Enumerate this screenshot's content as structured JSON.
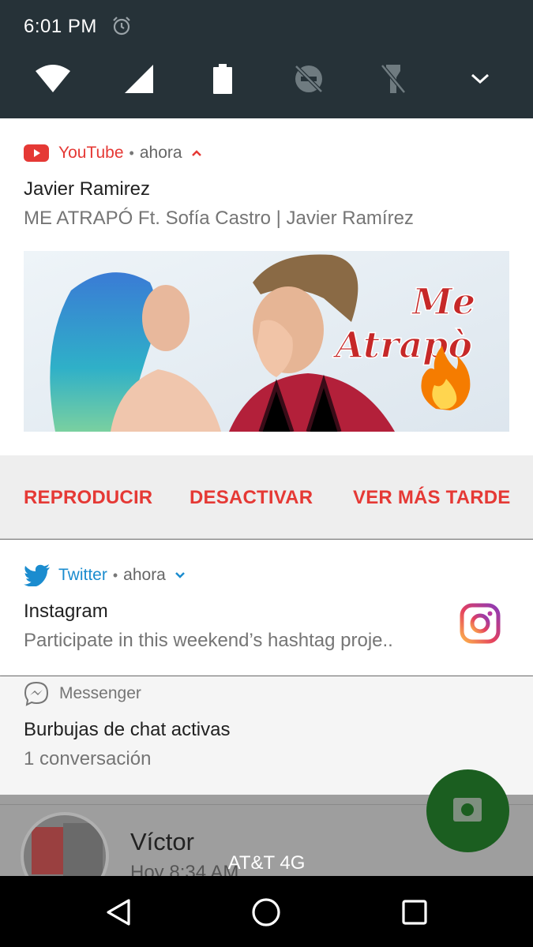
{
  "status_bar": {
    "time": "6:01 PM"
  },
  "youtube_notification": {
    "app_name": "YouTube",
    "time": "ahora",
    "title": "Javier Ramirez",
    "text": "ME ATRAPÓ Ft. Sofía Castro | Javier Ramírez",
    "thumbnail_text_line1": "Me",
    "thumbnail_text_line2": "Atrapò",
    "actions": [
      "REPRODUCIR",
      "DESACTIVAR",
      "VER MÁS TARDE"
    ],
    "accent_color": "#e53935"
  },
  "twitter_notification": {
    "app_name": "Twitter",
    "time": "ahora",
    "title": "Instagram",
    "text": "Participate in this weekend’s hashtag proje..",
    "accent_color": "#1b8ccf"
  },
  "messenger_notification": {
    "app_name": "Messenger",
    "title": "Burbujas de chat activas",
    "text": "1 conversación"
  },
  "background_app": {
    "contact_name": "Víctor",
    "contact_time": "Hoy 8:34 AM"
  },
  "carrier": "AT&T 4G"
}
